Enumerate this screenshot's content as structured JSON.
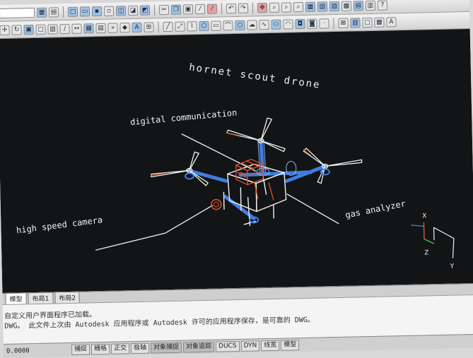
{
  "drawing": {
    "title": "hornet scout drone",
    "labels": {
      "communication": "digital communication",
      "camera": "high speed camera",
      "analyzer": "gas analyzer"
    },
    "ucs": {
      "x": "X",
      "y": "Y",
      "z": "Z"
    }
  },
  "tabs": [
    "模型",
    "布局1",
    "布局2"
  ],
  "command_lines": [
    "自定义用户界面程序已加载。",
    "DWG。 此文件上次由 Autodesk 应用程序或 Autodesk 许可的应用程序保存，是可靠的 DWG。"
  ],
  "status": {
    "coords": "0.0000",
    "buttons": [
      "捕捉",
      "栅格",
      "正交",
      "极轴",
      "对象捕捉",
      "对象追踪",
      "DUCS",
      "DYN",
      "线宽",
      "模型"
    ]
  },
  "colors": {
    "background": "#121415",
    "frame": "#3f7de0",
    "sketch": "#f2f2f2",
    "accent": "#e0502a"
  }
}
